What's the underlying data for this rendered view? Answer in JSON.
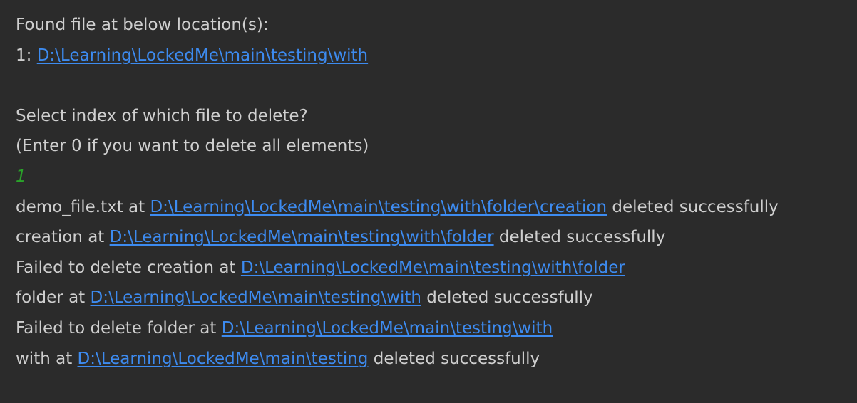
{
  "colors": {
    "background": "#2b2b2b",
    "text": "#cfcfcf",
    "link": "#3d8bf0",
    "user_input": "#2aa32a"
  },
  "console": {
    "line1": {
      "text": "Found file at below location(s):"
    },
    "line2": {
      "prefix": "1: ",
      "path": "D:\\Learning\\LockedMe\\main\\testing\\with"
    },
    "line3": {
      "text": ""
    },
    "line4": {
      "text": "Select index of which file to delete?"
    },
    "line5": {
      "text": "(Enter 0 if you want to delete all elements)"
    },
    "line6": {
      "input": "1"
    },
    "line7": {
      "prefix": "demo_file.txt at ",
      "path": "D:\\Learning\\LockedMe\\main\\testing\\with\\folder\\creation",
      "suffix": " deleted successfully"
    },
    "line8": {
      "prefix": "creation at ",
      "path": "D:\\Learning\\LockedMe\\main\\testing\\with\\folder",
      "suffix": " deleted successfully"
    },
    "line9": {
      "prefix": "Failed to delete creation at ",
      "path": "D:\\Learning\\LockedMe\\main\\testing\\with\\folder"
    },
    "line10": {
      "prefix": "folder at ",
      "path": "D:\\Learning\\LockedMe\\main\\testing\\with",
      "suffix": " deleted successfully"
    },
    "line11": {
      "prefix": "Failed to delete folder at ",
      "path": "D:\\Learning\\LockedMe\\main\\testing\\with"
    },
    "line12": {
      "prefix": "with at ",
      "path": "D:\\Learning\\LockedMe\\main\\testing",
      "suffix": " deleted successfully"
    }
  }
}
